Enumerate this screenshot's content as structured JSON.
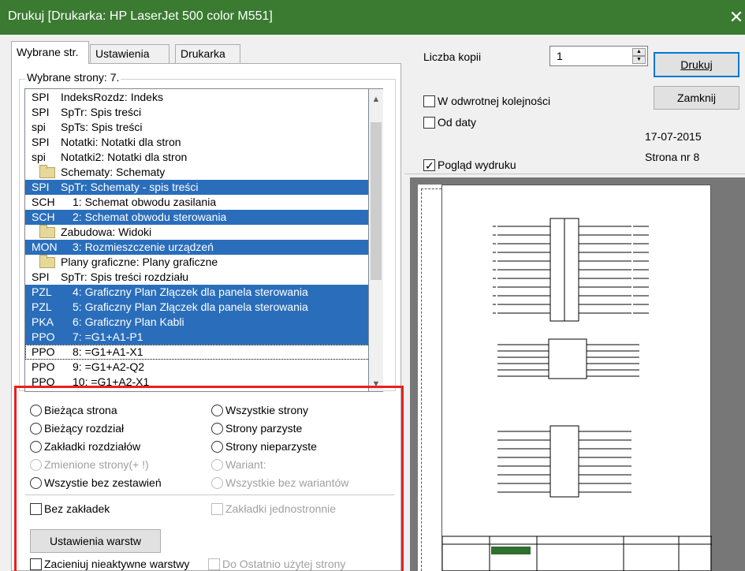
{
  "window": {
    "title": "Drukuj [Drukarka: HP LaserJet 500 color M551]",
    "close_glyph": "✕"
  },
  "tabs": [
    {
      "label": "Wybrane str."
    },
    {
      "label": "Ustawienia"
    },
    {
      "label": "Drukarka"
    }
  ],
  "pages_group": {
    "label": "Wybrane strony: 7.",
    "rows": [
      {
        "code": "SPI",
        "text": "IndeksRozdz: Indeks",
        "selected": false,
        "folder": false
      },
      {
        "code": "SPI",
        "text": "SpTr: Spis treści",
        "selected": false,
        "folder": false
      },
      {
        "code": "spi",
        "text": "SpTs: Spis treści",
        "selected": false,
        "folder": false
      },
      {
        "code": "SPI",
        "text": "Notatki: Notatki dla stron",
        "selected": false,
        "folder": false
      },
      {
        "code": "spi",
        "text": "Notatki2: Notatki dla stron",
        "selected": false,
        "folder": false
      },
      {
        "code": "",
        "text": "Schematy: Schematy",
        "selected": false,
        "folder": true
      },
      {
        "code": "SPI",
        "text": "SpTr: Schematy - spis treści",
        "selected": true,
        "folder": false
      },
      {
        "code": "SCH",
        "text": "1: Schemat obwodu zasilania",
        "selected": false,
        "folder": false
      },
      {
        "code": "SCH",
        "text": "2: Schemat obwodu sterowania",
        "selected": true,
        "folder": false
      },
      {
        "code": "",
        "text": "Zabudowa: Widoki",
        "selected": false,
        "folder": true
      },
      {
        "code": "MON",
        "text": "3: Rozmieszczenie urządzeń",
        "selected": true,
        "folder": false
      },
      {
        "code": "",
        "text": "Plany graficzne: Plany graficzne",
        "selected": false,
        "folder": true
      },
      {
        "code": "SPI",
        "text": "SpTr: Spis treści rozdziału",
        "selected": false,
        "folder": false
      },
      {
        "code": "PZL",
        "text": "4: Graficzny Plan Złączek dla panela sterowania",
        "selected": true,
        "folder": false
      },
      {
        "code": "PZL",
        "text": "5: Graficzny Plan Złączek dla panela sterowania",
        "selected": true,
        "folder": false
      },
      {
        "code": "PKA",
        "text": "6: Graficzny Plan Kabli",
        "selected": true,
        "folder": false
      },
      {
        "code": "PPO",
        "text": "7: =G1+A1-P1",
        "selected": true,
        "folder": false
      },
      {
        "code": "PPO",
        "text": "8: =G1+A1-X1",
        "selected": false,
        "folder": false,
        "focused": true
      },
      {
        "code": "PPO",
        "text": "9: =G1+A2-Q2",
        "selected": false,
        "folder": false
      },
      {
        "code": "PPO",
        "text": "10: =G1+A2-X1",
        "selected": false,
        "folder": false
      }
    ]
  },
  "options": {
    "current_page": "Bieżąca strona",
    "all_pages": "Wszystkie strony",
    "current_chapter": "Bieżący rozdział",
    "even_pages": "Strony parzyste",
    "chapter_tabs": "Zakładki rozdziałów",
    "odd_pages": "Strony nieparzyste",
    "changed_pages": "Zmienione strony(+ !)",
    "variant": "Wariant:",
    "all_without_summaries": "Wszystie bez zestawień",
    "all_without_variants": "Wszystkie bez wariantów",
    "no_tabs": "Bez zakładek",
    "tabs_one_side": "Zakładki jednostronnie",
    "layer_settings": "Ustawienia warstw",
    "shade_inactive": "Zacieniuj nieaktywne warstwy",
    "to_last_used": "Do Ostatnio użytej strony"
  },
  "right": {
    "copies_label": "Liczba kopii",
    "copies_value": "1",
    "print_button": "Drukuj",
    "close_button": "Zamknij",
    "reverse_order": "W odwrotnej kolejności",
    "from_date": "Od daty",
    "date": "17-07-2015",
    "page_no": "Strona nr 8",
    "preview_check": "Pogląd wydruku",
    "preview_checked": true
  }
}
